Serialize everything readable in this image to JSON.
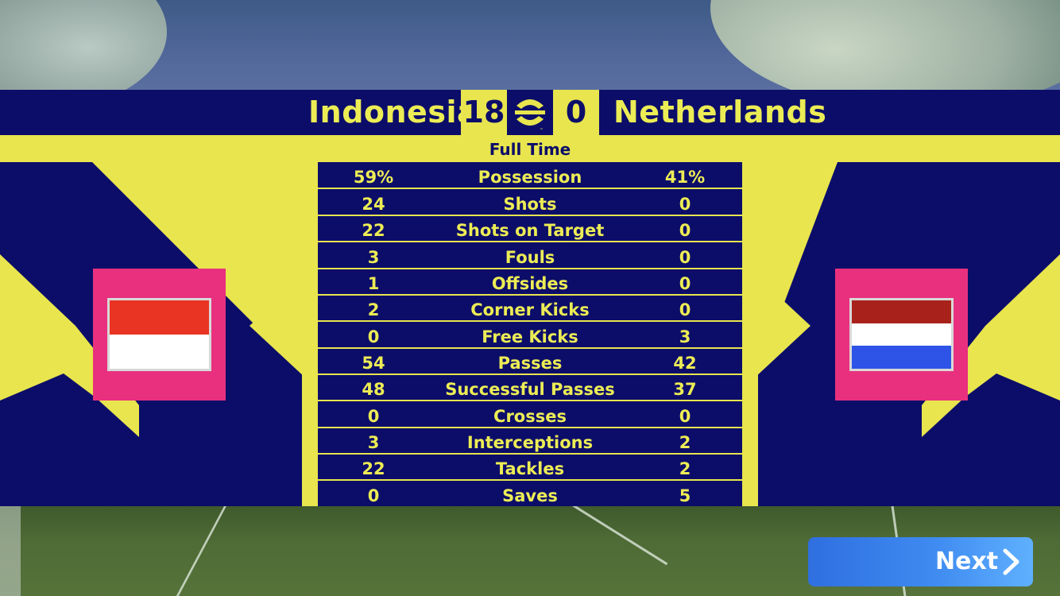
{
  "match": {
    "home_team": "Indonesia",
    "away_team": "Netherlands",
    "home_score": "18",
    "away_score": "0",
    "status": "Full Time"
  },
  "flags": {
    "home": {
      "icon": "indonesia-flag",
      "stripes": [
        "#e93424",
        "#ffffff"
      ]
    },
    "away": {
      "icon": "netherlands-flag",
      "stripes": [
        "#a8221b",
        "#ffffff",
        "#2d54e6"
      ]
    }
  },
  "stats": [
    {
      "label": "Possession",
      "home": "59%",
      "away": "41%"
    },
    {
      "label": "Shots",
      "home": "24",
      "away": "0"
    },
    {
      "label": "Shots on Target",
      "home": "22",
      "away": "0"
    },
    {
      "label": "Fouls",
      "home": "3",
      "away": "0"
    },
    {
      "label": "Offsides",
      "home": "1",
      "away": "0"
    },
    {
      "label": "Corner Kicks",
      "home": "2",
      "away": "0"
    },
    {
      "label": "Free Kicks",
      "home": "0",
      "away": "3"
    },
    {
      "label": "Passes",
      "home": "54",
      "away": "42"
    },
    {
      "label": "Successful Passes",
      "home": "48",
      "away": "37"
    },
    {
      "label": "Crosses",
      "home": "0",
      "away": "0"
    },
    {
      "label": "Interceptions",
      "home": "3",
      "away": "2"
    },
    {
      "label": "Tackles",
      "home": "22",
      "away": "2"
    },
    {
      "label": "Saves",
      "home": "0",
      "away": "5"
    }
  ],
  "actions": {
    "next_label": "Next"
  },
  "colors": {
    "navy": "#0c0d69",
    "yellow": "#e8e54e",
    "magenta": "#e8307e",
    "button_blue": "#3e8af0"
  },
  "icons": {
    "logo": "efootball-logo-icon",
    "next": "chevron-right-icon"
  }
}
